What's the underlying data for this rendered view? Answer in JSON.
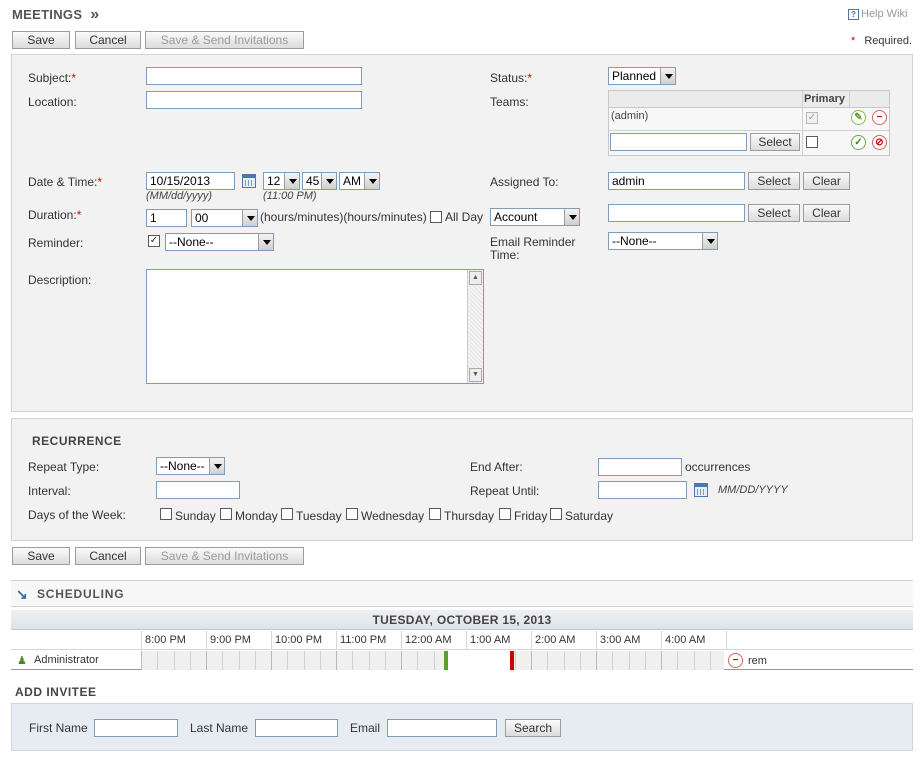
{
  "header": {
    "title": "MEETINGS",
    "arrow": "»",
    "help_label": "Help Wiki",
    "required_star": "*",
    "required_label": "Required."
  },
  "buttons": {
    "save": "Save",
    "cancel": "Cancel",
    "save_send": "Save & Send Invitations"
  },
  "form": {
    "subject_label": "Subject:",
    "subject_value": "",
    "location_label": "Location:",
    "location_value": "",
    "status_label": "Status:",
    "status_value": "Planned",
    "teams_label": "Teams:",
    "teams_primary_header": "Primary",
    "teams_row_name": "(admin)",
    "teams_select_button": "Select",
    "datetime_label": "Date & Time:",
    "date_value": "10/15/2013",
    "hour_value": "12",
    "minute_value": "45",
    "ampm_value": "AM",
    "date_format_hint": "(MM/dd/yyyy)",
    "time_hint": "(11:00 PM)",
    "assigned_label": "Assigned To:",
    "assigned_value": "admin",
    "assigned_select": "Select",
    "assigned_clear": "Clear",
    "duration_label": "Duration:",
    "duration_hours": "1",
    "duration_minutes": "00",
    "duration_units": "(hours/minutes)(hours/minutes)",
    "all_day_label": "All Day",
    "parent_type": "Account",
    "parent_select": "Select",
    "parent_clear": "Clear",
    "reminder_label": "Reminder:",
    "reminder_value": "--None--",
    "email_reminder_label": "Email Reminder Time:",
    "email_reminder_value": "--None--",
    "description_label": "Description:"
  },
  "recurrence": {
    "title": "RECURRENCE",
    "repeat_type_label": "Repeat Type:",
    "repeat_type_value": "--None--",
    "interval_label": "Interval:",
    "days_label": "Days of the Week:",
    "days": [
      "Sunday",
      "Monday",
      "Tuesday",
      "Wednesday",
      "Thursday",
      "Friday",
      "Saturday"
    ],
    "end_after_label": "End After:",
    "occurrences_label": "occurrences",
    "repeat_until_label": "Repeat Until:",
    "date_hint": "MM/DD/YYYY"
  },
  "scheduling": {
    "title": "SCHEDULING",
    "date_header": "TUESDAY, OCTOBER 15, 2013",
    "times": [
      "8:00 PM",
      "9:00 PM",
      "10:00 PM",
      "11:00 PM",
      "12:00 AM",
      "1:00 AM",
      "2:00 AM",
      "3:00 AM",
      "4:00 AM"
    ],
    "attendee": "Administrator",
    "remove_label": "rem"
  },
  "add_invitee": {
    "title": "ADD INVITEE",
    "first_name_label": "First Name",
    "last_name_label": "Last Name",
    "email_label": "Email",
    "search_button": "Search"
  },
  "colors": {
    "required": "#dd0000",
    "meeting_start": "#5aa02c",
    "meeting_end": "#cc0000",
    "panel_bg": "#f2f2f2"
  }
}
